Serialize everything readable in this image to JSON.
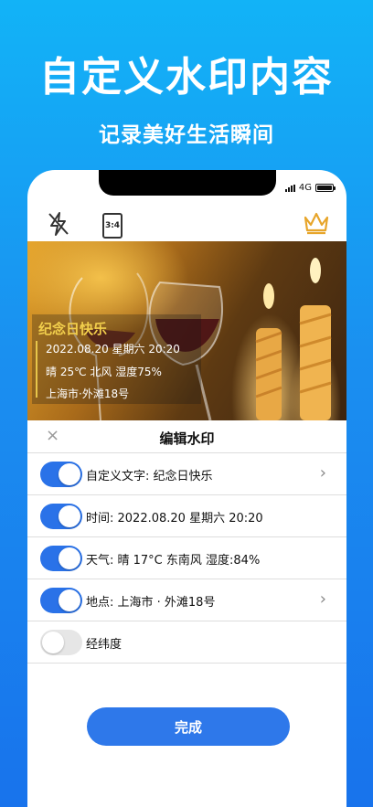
{
  "promo": {
    "headline": "自定义水印内容",
    "subhead": "记录美好生活瞬间"
  },
  "status_bar": {
    "network": "4G"
  },
  "toolbar": {
    "ratio_label": "3:4",
    "icons": [
      "flash-off-icon",
      "aspect-ratio-icon",
      "crown-icon"
    ]
  },
  "watermark": {
    "title": "纪念日快乐",
    "datetime": "2022.08.20  星期六 20:20",
    "weather": "晴 25℃ 北风 湿度75%",
    "location": "上海市·外滩18号"
  },
  "sheet": {
    "close_glyph": "×",
    "title": "编辑水印",
    "rows": [
      {
        "label": "自定义文字: 纪念日快乐",
        "enabled": true,
        "has_arrow": true
      },
      {
        "label": "时间: 2022.08.20  星期六 20:20",
        "enabled": true,
        "has_arrow": false
      },
      {
        "label": "天气: 晴 17°C 东南风 湿度:84%",
        "enabled": true,
        "has_arrow": false
      },
      {
        "label": "地点: 上海市 · 外滩18号",
        "enabled": true,
        "has_arrow": true
      },
      {
        "label": "经纬度",
        "enabled": false,
        "has_arrow": false
      }
    ],
    "done_label": "完成"
  },
  "colors": {
    "accent": "#2a72e8",
    "watermark_title": "#f2cf4c",
    "crown": "#e7a52a"
  }
}
